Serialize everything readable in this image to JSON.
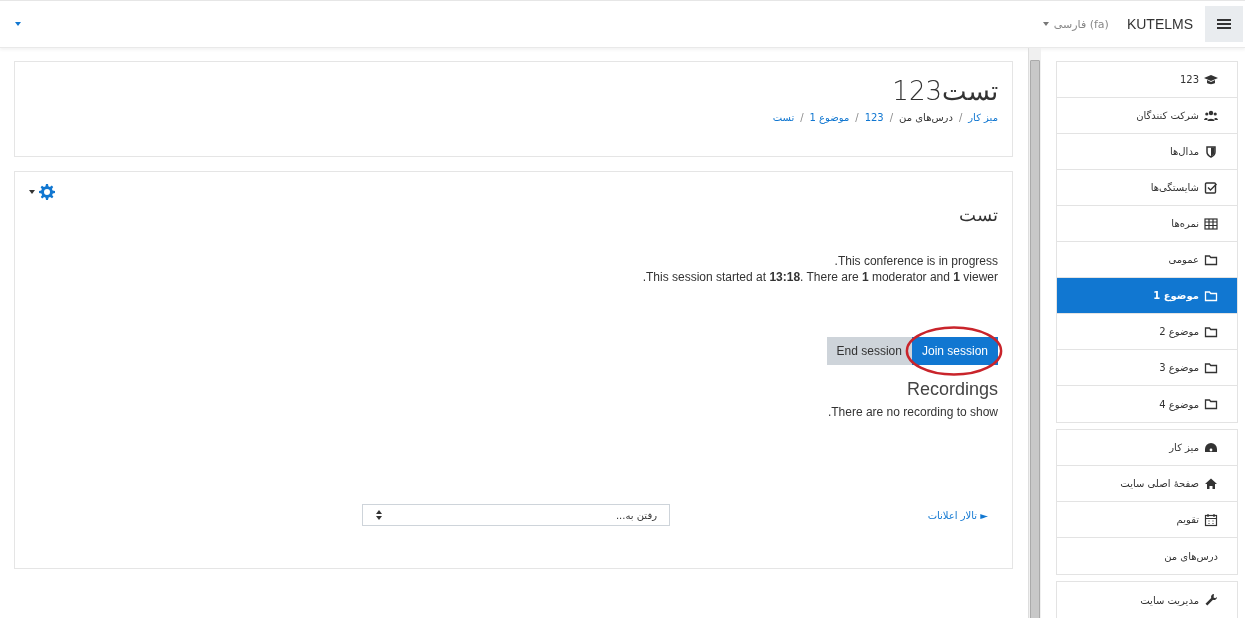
{
  "navbar": {
    "site_name": "KUTELMS",
    "language": "فارسی (fa)"
  },
  "header": {
    "title": "تست123",
    "separator": "/",
    "breadcrumb": [
      {
        "label": "میز کار",
        "link": true
      },
      {
        "label": "درس‌های من",
        "link": false
      },
      {
        "label": "123",
        "link": true
      },
      {
        "label": "موضوع 1",
        "link": true
      },
      {
        "label": "تست",
        "link": true
      }
    ]
  },
  "activity": {
    "title": "تست",
    "status": ".This conference is in progress",
    "session_info": ".This session started at **13:18**. There are **1** moderator and **1** viewer",
    "buttons": [
      {
        "label": "Join session",
        "kind": "primary"
      },
      {
        "label": "End session",
        "kind": "secondary"
      }
    ],
    "recordings_title": "Recordings",
    "recordings_message": ".There are no recording to show",
    "prev_link": "► تالار اعلانات",
    "jump_placeholder": "رفتن به..."
  },
  "sidebar": {
    "groups": [
      [
        {
          "label": "123",
          "selected": false
        },
        {
          "label": "شرکت کنندگان",
          "selected": false
        },
        {
          "label": "مدال‌ها",
          "selected": false
        },
        {
          "label": "شایستگی‌ها",
          "selected": false
        },
        {
          "label": "نمره‌ها",
          "selected": false
        },
        {
          "label": "عمومی",
          "selected": false
        },
        {
          "label": "موضوع 1",
          "selected": true
        },
        {
          "label": "موضوع 2",
          "selected": false
        },
        {
          "label": "موضوع 3",
          "selected": false
        },
        {
          "label": "موضوع 4",
          "selected": false
        }
      ],
      [
        {
          "label": "میز کار",
          "selected": false
        },
        {
          "label": "صفحهٔ اصلی سایت",
          "selected": false
        },
        {
          "label": "تقویم",
          "selected": false
        },
        {
          "label": "درس‌های من",
          "selected": false
        }
      ],
      [
        {
          "label": "مدیریت سایت",
          "selected": false
        }
      ]
    ]
  }
}
